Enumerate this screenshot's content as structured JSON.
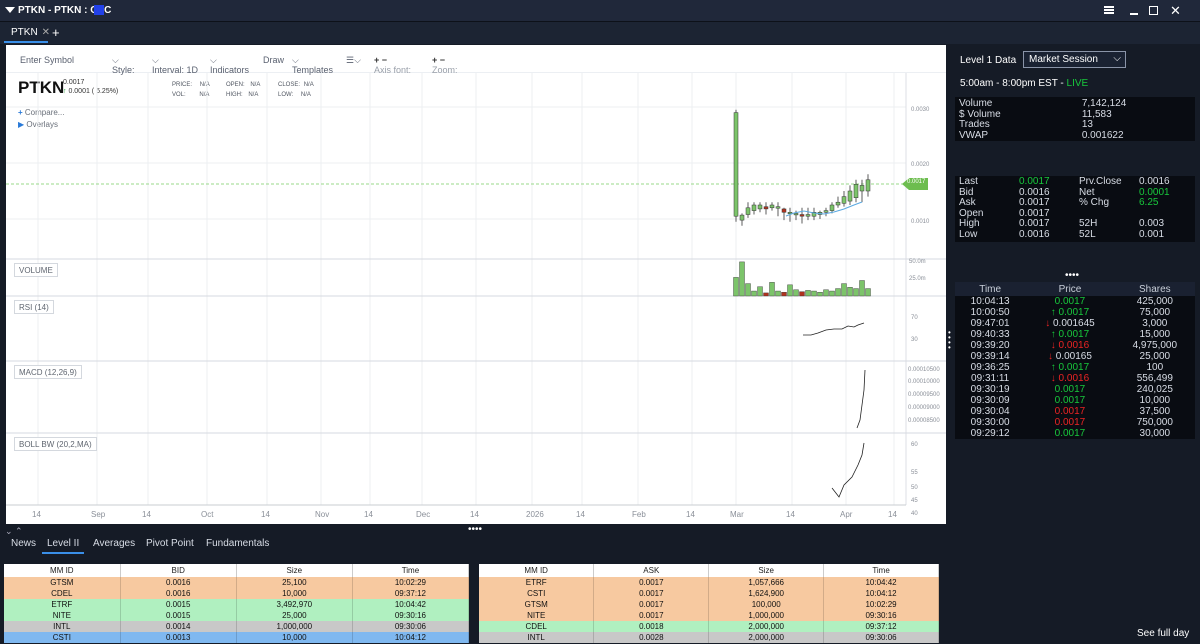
{
  "window": {
    "title": "PTKN - PTKN : OTC",
    "accent": "#2241e8"
  },
  "tabs": [
    {
      "label": "PTKN"
    }
  ],
  "toolbar": {
    "symbol_placeholder": "Enter Symbol",
    "style": "Style:",
    "interval": "Interval: 1D",
    "indicators": "Indicators",
    "draw": "Draw",
    "templates": "Templates",
    "axis_font": "Axis font:",
    "zoom": "Zoom:"
  },
  "quote": {
    "symbol": "PTKN",
    "last": "0.0017",
    "change": "0.0001 ( 6.25%)",
    "price_label": "PRICE:",
    "price": "N/A",
    "vol_label": "VOL:",
    "vol": "N/A",
    "open_label": "OPEN:",
    "open": "N/A",
    "high_label": "HIGH:",
    "high": "N/A",
    "close_label": "CLOSE:",
    "close": "N/A",
    "low_label": "LOW:",
    "low": "N/A",
    "compare": "Compare...",
    "overlays": "Overlays"
  },
  "panes": {
    "volume": "VOLUME",
    "rsi": "RSI (14)",
    "macd": "MACD (12,26,9)",
    "boll": "BOLL BW (20,2,MA)"
  },
  "axes": {
    "price_ticks": [
      "0.0030",
      "0.0020",
      "0.0010"
    ],
    "price_marker": "0.0017",
    "volume_ticks": [
      "50.0m",
      "25.0m"
    ],
    "rsi_ticks": [
      "70",
      "30"
    ],
    "macd_ticks": [
      "0.00010500",
      "0.00010000",
      "0.00009500",
      "0.00009000",
      "0.00008500"
    ],
    "boll_ticks": [
      "60",
      "55",
      "50",
      "45",
      "40"
    ],
    "x_ticks": [
      "14",
      "Sep",
      "14",
      "Oct",
      "14",
      "Nov",
      "14",
      "Dec",
      "14",
      "2026",
      "14",
      "Feb",
      "14",
      "Mar",
      "14",
      "Apr",
      "14"
    ]
  },
  "chart_data": {
    "type": "candlestick",
    "series": [
      {
        "ohlc": [
          [
            0.00105,
            0.0029,
            0.00095,
            0.00295
          ],
          [
            0.00098,
            0.00107,
            0.00088,
            0.0011
          ],
          [
            0.00108,
            0.0012,
            0.00102,
            0.0013
          ],
          [
            0.00115,
            0.00125,
            0.00108,
            0.0013
          ],
          [
            0.00118,
            0.00125,
            0.00112,
            0.0013
          ],
          [
            0.00122,
            0.00118,
            0.00108,
            0.0013
          ],
          [
            0.0012,
            0.00125,
            0.00115,
            0.0013
          ],
          [
            0.00122,
            0.00122,
            0.00105,
            0.0013
          ],
          [
            0.00118,
            0.00112,
            0.00098,
            0.0012
          ],
          [
            0.0011,
            0.00112,
            0.00095,
            0.0012
          ],
          [
            0.00108,
            0.0011,
            0.00098,
            0.00115
          ],
          [
            0.00108,
            0.00105,
            0.00092,
            0.0012
          ],
          [
            0.00105,
            0.00108,
            0.00098,
            0.0012
          ],
          [
            0.00105,
            0.00112,
            0.00098,
            0.0012
          ],
          [
            0.00108,
            0.00112,
            0.001,
            0.00115
          ],
          [
            0.00112,
            0.00115,
            0.00105,
            0.0012
          ],
          [
            0.00115,
            0.00125,
            0.0011,
            0.0013
          ],
          [
            0.00125,
            0.0013,
            0.0012,
            0.0014
          ],
          [
            0.00128,
            0.0014,
            0.00122,
            0.0015
          ],
          [
            0.00132,
            0.0015,
            0.00125,
            0.0016
          ],
          [
            0.00138,
            0.00162,
            0.0013,
            0.0017
          ],
          [
            0.0015,
            0.0016,
            0.0013,
            0.0017
          ],
          [
            0.0015,
            0.0017,
            0.0014,
            0.0018
          ]
        ]
      },
      {
        "volume_m": [
          30,
          55,
          20,
          8,
          15,
          5,
          22,
          8,
          6,
          18,
          10,
          7,
          9,
          8,
          6,
          10,
          8,
          12,
          20,
          14,
          12,
          25,
          12
        ]
      }
    ]
  },
  "level1": {
    "title": "Level 1 Data",
    "session": "Market Session",
    "hours": "5:00am - 8:00pm EST - ",
    "live": "LIVE",
    "stats": [
      [
        "Volume",
        "7,142,124"
      ],
      [
        "$ Volume",
        "11,583"
      ],
      [
        " Trades",
        "13"
      ],
      [
        " VWAP",
        "0.001622"
      ]
    ],
    "quote": [
      [
        "Last",
        "0.0017",
        "Prv.Close",
        "0.0016"
      ],
      [
        "Bid",
        "0.0016",
        "Net",
        "0.0001"
      ],
      [
        "Ask",
        "0.0017",
        "% Chg",
        "6.25"
      ],
      [
        "Open",
        "0.0017",
        "",
        ""
      ],
      [
        "High",
        "0.0017",
        "52H",
        "0.003"
      ],
      [
        "Low",
        "0.0016",
        "52L",
        "0.001"
      ]
    ]
  },
  "time_sales": {
    "headers": [
      "Time",
      "Price",
      "Shares"
    ],
    "rows": [
      [
        "10:04:13",
        "0.0017",
        "425,000",
        "g",
        ""
      ],
      [
        "10:00:50",
        "0.0017",
        "75,000",
        "g",
        "up"
      ],
      [
        "09:47:01",
        "0.001645",
        "3,000",
        "w",
        "down"
      ],
      [
        "09:40:33",
        "0.0017",
        "15,000",
        "g",
        "up"
      ],
      [
        "09:39:20",
        "0.0016",
        "4,975,000",
        "r",
        "down"
      ],
      [
        "09:39:14",
        "0.00165",
        "25,000",
        "w",
        "down"
      ],
      [
        "09:36:25",
        "0.0017",
        "100",
        "g",
        "up"
      ],
      [
        "09:31:11",
        "0.0016",
        "556,499",
        "r",
        "down"
      ],
      [
        "09:30:19",
        "0.0017",
        "240,025",
        "g",
        ""
      ],
      [
        "09:30:09",
        "0.0017",
        "10,000",
        "g",
        ""
      ],
      [
        "09:30:04",
        "0.0017",
        "37,500",
        "r",
        ""
      ],
      [
        "09:30:00",
        "0.0017",
        "750,000",
        "r",
        ""
      ],
      [
        "09:29:12",
        "0.0017",
        "30,000",
        "g",
        ""
      ]
    ],
    "see_full_day": "See full day"
  },
  "bottom_tabs": [
    "News",
    "Level II",
    "Averages",
    "Pivot Point",
    "Fundamentals"
  ],
  "level2_bid": {
    "headers": [
      "MM ID",
      "BID",
      "Size",
      "Time"
    ],
    "rows": [
      [
        "GTSM",
        "0.0016",
        "25,100",
        "10:02:29",
        "#f7c9a0"
      ],
      [
        "CDEL",
        "0.0016",
        "10,000",
        "09:37:12",
        "#f7c9a0"
      ],
      [
        "ETRF",
        "0.0015",
        "3,492,970",
        "10:04:42",
        "#b0f0c0"
      ],
      [
        "NITE",
        "0.0015",
        "25,000",
        "09:30:16",
        "#b0f0c0"
      ],
      [
        "INTL",
        "0.0014",
        "1,000,000",
        "09:30:06",
        "#c8c8c8"
      ],
      [
        "CSTI",
        "0.0013",
        "10,000",
        "10:04:12",
        "#7fb8f0"
      ]
    ]
  },
  "level2_ask": {
    "headers": [
      "MM ID",
      "ASK",
      "Size",
      "Time"
    ],
    "rows": [
      [
        "ETRF",
        "0.0017",
        "1,057,666",
        "10:04:42",
        "#f7c9a0"
      ],
      [
        "CSTI",
        "0.0017",
        "1,624,900",
        "10:04:12",
        "#f7c9a0"
      ],
      [
        "GTSM",
        "0.0017",
        "100,000",
        "10:02:29",
        "#f7c9a0"
      ],
      [
        "NITE",
        "0.0017",
        "1,000,000",
        "09:30:16",
        "#f7c9a0"
      ],
      [
        "CDEL",
        "0.0018",
        "2,000,000",
        "09:37:12",
        "#b0f0c0"
      ],
      [
        "INTL",
        "0.0028",
        "2,000,000",
        "09:30:06",
        "#c8c8c8"
      ]
    ]
  }
}
